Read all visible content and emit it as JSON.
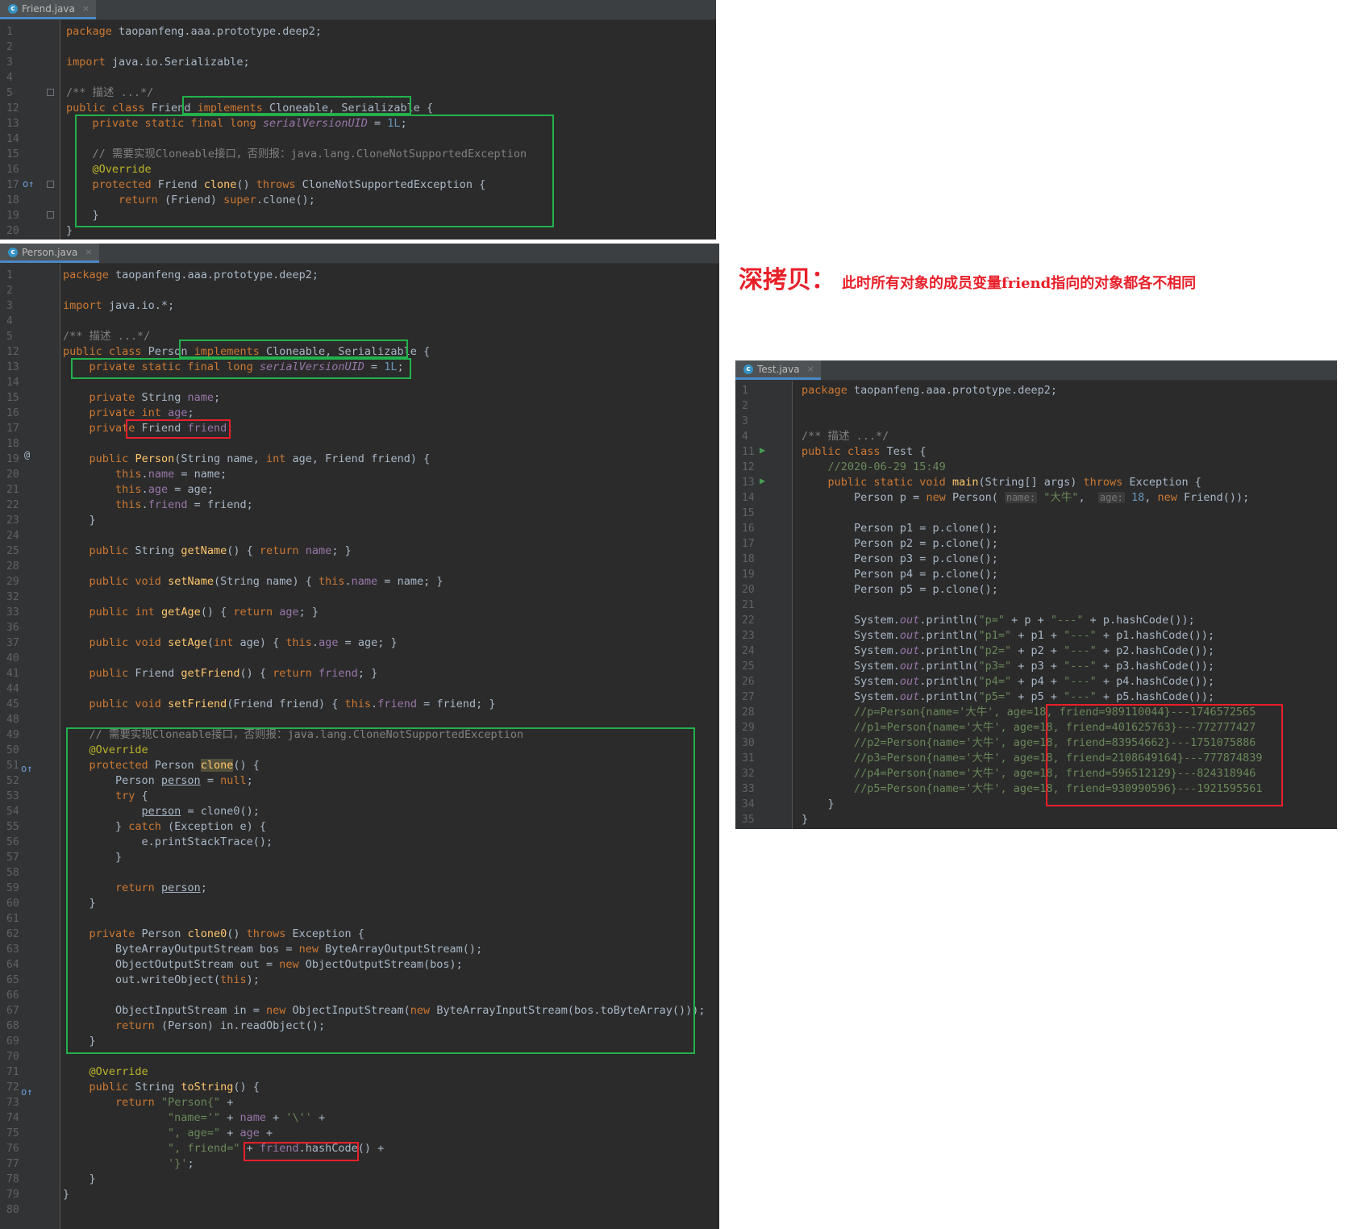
{
  "friend_panel": {
    "tab": "Friend.java",
    "line_numbers": [
      "1",
      "2",
      "3",
      "4",
      "5",
      "12",
      "13",
      "14",
      "15",
      "16",
      "17",
      "18",
      "19",
      "20"
    ],
    "lines": [
      "<span class=\"kw\">package</span> taopanfeng.aaa.prototype.deep2;",
      "",
      "<span class=\"kw\">import</span> java.io.Serializable;",
      "",
      "<span class=\"cm\">/** 描述 ...*/</span>",
      "<span class=\"kw\">public class</span> Friend <span class=\"kw\">implements</span> Cloneable, Serializable {",
      "    <span class=\"kw\">private static final long</span> <span class=\"sfld\">serialVersionUID</span> = <span class=\"num\">1L</span>;",
      "",
      "    <span class=\"cm\">// 需要实现Cloneable接口，否则报：java.lang.CloneNotSupportedException</span>",
      "    <span class=\"ann\">@Override</span>",
      "    <span class=\"kw\">protected</span> Friend <span class=\"fn\">clone</span>() <span class=\"kw\">throws</span> CloneNotSupportedException {",
      "        <span class=\"kw\">return</span> (Friend) <span class=\"kw\">super</span>.clone();",
      "    }",
      "}"
    ]
  },
  "person_panel": {
    "tab": "Person.java",
    "line_numbers": [
      "1",
      "2",
      "3",
      "4",
      "5",
      "12",
      "13",
      "14",
      "15",
      "16",
      "17",
      "18",
      "19",
      "20",
      "21",
      "22",
      "23",
      "24",
      "25",
      "28",
      "29",
      "32",
      "33",
      "36",
      "37",
      "40",
      "41",
      "44",
      "45",
      "48",
      "49",
      "50",
      "51",
      "52",
      "53",
      "54",
      "55",
      "56",
      "57",
      "58",
      "59",
      "60",
      "61",
      "62",
      "63",
      "64",
      "65",
      "66",
      "67",
      "68",
      "69",
      "70",
      "71",
      "72",
      "73",
      "74",
      "75",
      "76",
      "77",
      "78",
      "79",
      "80"
    ],
    "lines": [
      "<span class=\"kw\">package</span> taopanfeng.aaa.prototype.deep2;",
      "",
      "<span class=\"kw\">import</span> java.io.*;",
      "",
      "<span class=\"cm\">/** 描述 ...*/</span>",
      "<span class=\"kw\">public class</span> Person <span class=\"kw\">implements</span> Cloneable, Serializable {",
      "    <span class=\"kw\">private static final long</span> <span class=\"sfld\">serialVersionUID</span> = <span class=\"num\">1L</span>;",
      "",
      "    <span class=\"kw\">private</span> String <span class=\"fld\">name</span>;",
      "    <span class=\"kw\">private int</span> <span class=\"fld\">age</span>;",
      "    <span class=\"kw\">private</span> Friend <span class=\"fld\">friend</span>;",
      "",
      "    <span class=\"kw\">public</span> <span class=\"fn\">Person</span>(String name, <span class=\"kw\">int</span> age, Friend friend) {",
      "        <span class=\"kw\">this</span>.<span class=\"fld\">name</span> = name;",
      "        <span class=\"kw\">this</span>.<span class=\"fld\">age</span> = age;",
      "        <span class=\"kw\">this</span>.<span class=\"fld\">friend</span> = friend;",
      "    }",
      "",
      "    <span class=\"kw\">public</span> String <span class=\"fn\">getName</span>() { <span class=\"kw\">return</span> <span class=\"fld\">name</span>; }",
      "",
      "    <span class=\"kw\">public void</span> <span class=\"fn\">setName</span>(String name) { <span class=\"kw\">this</span>.<span class=\"fld\">name</span> = name; }",
      "",
      "    <span class=\"kw\">public int</span> <span class=\"fn\">getAge</span>() { <span class=\"kw\">return</span> <span class=\"fld\">age</span>; }",
      "",
      "    <span class=\"kw\">public void</span> <span class=\"fn\">setAge</span>(<span class=\"kw\">int</span> age) { <span class=\"kw\">this</span>.<span class=\"fld\">age</span> = age; }",
      "",
      "    <span class=\"kw\">public</span> Friend <span class=\"fn\">getFriend</span>() { <span class=\"kw\">return</span> <span class=\"fld\">friend</span>; }",
      "",
      "    <span class=\"kw\">public void</span> <span class=\"fn\">setFriend</span>(Friend friend) { <span class=\"kw\">this</span>.<span class=\"fld\">friend</span> = friend; }",
      "",
      "    <span class=\"cm\">// 需要实现Cloneable接口，否则报：java.lang.CloneNotSupportedException</span>",
      "    <span class=\"ann\">@Override</span>",
      "    <span class=\"kw\">protected</span> Person <span class=\"fn hl\">clone</span>() {",
      "        Person <span class=\"ul\">person</span> = <span class=\"kw\">null</span>;",
      "        <span class=\"kw\">try</span> {",
      "            <span class=\"ul\">person</span> = clone0();",
      "        } <span class=\"kw\">catch</span> (Exception e) {",
      "            e.printStackTrace();",
      "        }",
      "",
      "        <span class=\"kw\">return</span> <span class=\"ul\">person</span>;",
      "    }",
      "",
      "    <span class=\"kw\">private</span> Person <span class=\"fn\">clone0</span>() <span class=\"kw\">throws</span> Exception {",
      "        ByteArrayOutputStream bos = <span class=\"kw\">new</span> ByteArrayOutputStream();",
      "        ObjectOutputStream out = <span class=\"kw\">new</span> ObjectOutputStream(bos);",
      "        out.writeObject(<span class=\"kw\">this</span>);",
      "",
      "        ObjectInputStream in = <span class=\"kw\">new</span> ObjectInputStream(<span class=\"kw\">new</span> ByteArrayInputStream(bos.toByteArray()));",
      "        <span class=\"kw\">return</span> (Person) in.readObject();",
      "    }",
      "",
      "    <span class=\"ann\">@Override</span>",
      "    <span class=\"kw\">public</span> String <span class=\"fn\">toString</span>() {",
      "        <span class=\"kw\">return</span> <span class=\"str\">\"Person{\"</span> +",
      "                <span class=\"str\">\"name='\"</span> + <span class=\"fld\">name</span> + <span class=\"str\">'\\''</span> +",
      "                <span class=\"str\">\", age=\"</span> + <span class=\"fld\">age</span> +",
      "                <span class=\"str\">\", friend=\"</span> + <span class=\"fld\">friend</span>.hashCode() +",
      "                <span class=\"str\">'}'</span>;",
      "    }",
      "}",
      ""
    ]
  },
  "test_panel": {
    "tab": "Test.java",
    "line_numbers": [
      "1",
      "2",
      "3",
      "4",
      "11",
      "12",
      "13",
      "14",
      "15",
      "16",
      "17",
      "18",
      "19",
      "20",
      "21",
      "22",
      "23",
      "24",
      "25",
      "26",
      "27",
      "28",
      "29",
      "30",
      "31",
      "32",
      "33",
      "34",
      "35"
    ],
    "lines": [
      "<span class=\"kw\">package</span> taopanfeng.aaa.prototype.deep2;",
      "",
      "",
      "<span class=\"cm\">/** 描述 ...*/</span>",
      "<span class=\"kw\">public class</span> Test {",
      "    <span class=\"str\">//2020-06-29 15:49</span>",
      "    <span class=\"kw\">public static void</span> <span class=\"fn\">main</span>(String[] args) <span class=\"kw\">throws</span> Exception {",
      "        Person p = <span class=\"kw\">new</span> Person( <span class=\"hint\">name:</span> <span class=\"str\">\"大牛\"</span>,  <span class=\"hint\">age:</span> <span class=\"num\">18</span>, <span class=\"kw\">new</span> Friend());",
      "",
      "        Person p1 = p.clone();",
      "        Person p2 = p.clone();",
      "        Person p3 = p.clone();",
      "        Person p4 = p.clone();",
      "        Person p5 = p.clone();",
      "",
      "        System.<span class=\"sfld\">out</span>.println(<span class=\"str\">\"p=\"</span> + p + <span class=\"str\">\"---\"</span> + p.hashCode());",
      "        System.<span class=\"sfld\">out</span>.println(<span class=\"str\">\"p1=\"</span> + p1 + <span class=\"str\">\"---\"</span> + p1.hashCode());",
      "        System.<span class=\"sfld\">out</span>.println(<span class=\"str\">\"p2=\"</span> + p2 + <span class=\"str\">\"---\"</span> + p2.hashCode());",
      "        System.<span class=\"sfld\">out</span>.println(<span class=\"str\">\"p3=\"</span> + p3 + <span class=\"str\">\"---\"</span> + p3.hashCode());",
      "        System.<span class=\"sfld\">out</span>.println(<span class=\"str\">\"p4=\"</span> + p4 + <span class=\"str\">\"---\"</span> + p4.hashCode());",
      "        System.<span class=\"sfld\">out</span>.println(<span class=\"str\">\"p5=\"</span> + p5 + <span class=\"str\">\"---\"</span> + p5.hashCode());",
      "        <span class=\"str\">//p=Person{name='大牛', age=18, friend=989110044}---1746572565</span>",
      "        <span class=\"str\">//p1=Person{name='大牛', age=18, friend=401625763}---772777427</span>",
      "        <span class=\"str\">//p2=Person{name='大牛', age=18, friend=83954662}---1751075886</span>",
      "        <span class=\"str\">//p3=Person{name='大牛', age=18, friend=2108649164}---777874839</span>",
      "        <span class=\"str\">//p4=Person{name='大牛', age=18, friend=596512129}---824318946</span>",
      "        <span class=\"str\">//p5=Person{name='大牛', age=18, friend=930990596}---1921595561</span>",
      "    }",
      "}"
    ]
  },
  "caption": {
    "title": "深拷贝：",
    "text": "此时所有对象的成员变量friend指向的对象都各不相同"
  },
  "colors": {
    "editor_bg": "#2b2b2b",
    "keyword": "#cc7832",
    "string": "#6a8759",
    "highlight_green": "#22b14c",
    "highlight_red": "#e8202a"
  }
}
